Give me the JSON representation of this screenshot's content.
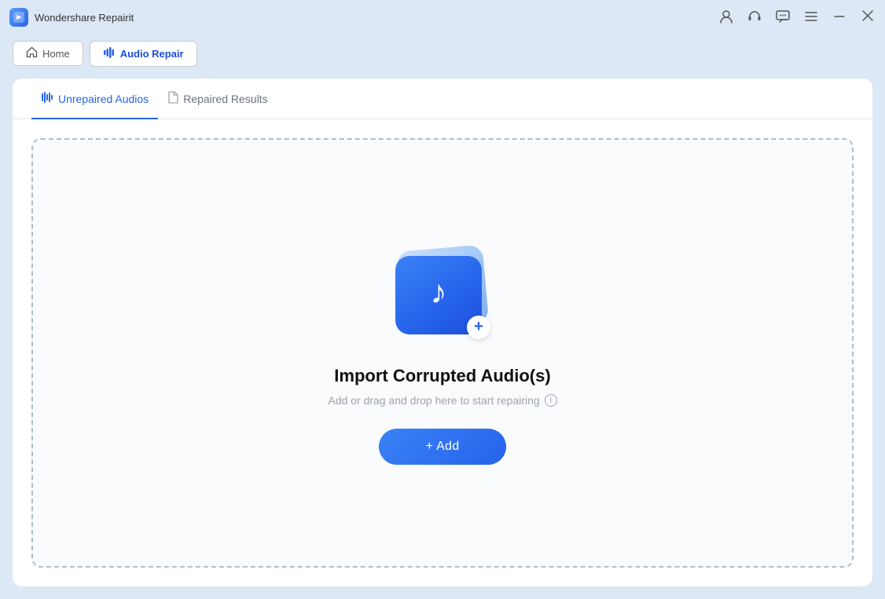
{
  "app": {
    "title": "Wondershare Repairit",
    "icon_label": "R"
  },
  "titlebar": {
    "icons": [
      "person",
      "headphones",
      "chat",
      "menu",
      "minimize",
      "close"
    ]
  },
  "navbar": {
    "home_label": "Home",
    "active_tab_label": "Audio Repair"
  },
  "tabs": {
    "unrepaired": "Unrepaired Audios",
    "repaired": "Repaired Results"
  },
  "dropzone": {
    "title": "Import Corrupted Audio(s)",
    "subtitle": "Add or drag and drop here to start repairing",
    "add_button": "+ Add"
  }
}
